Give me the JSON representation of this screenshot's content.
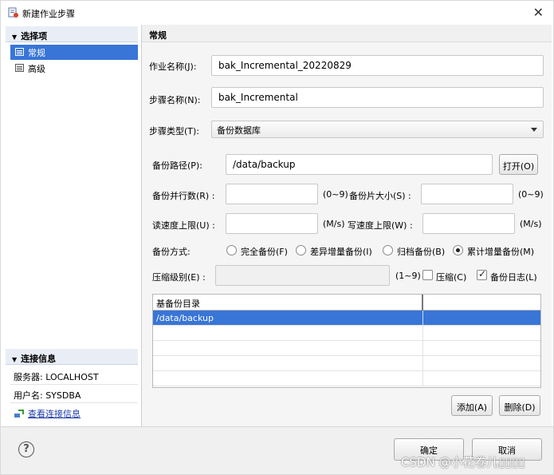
{
  "window": {
    "title": "新建作业步骤",
    "close_glyph": "✕"
  },
  "nav": {
    "header": "选择项",
    "items": [
      {
        "label": "常规",
        "selected": true
      },
      {
        "label": "高级",
        "selected": false
      }
    ]
  },
  "connection": {
    "header": "连接信息",
    "server": "服务器: LOCALHOST",
    "user": "用户名: SYSDBA",
    "view_link": "查看连接信息"
  },
  "page": {
    "title": "常规"
  },
  "form": {
    "job_name_label": "作业名称(J):",
    "job_name_value": "bak_Incremental_20220829",
    "step_name_label": "步骤名称(N):",
    "step_name_value": "bak_Incremental",
    "step_type_label": "步骤类型(T):",
    "step_type_value": "备份数据库",
    "backup_path_label": "备份路径(P):",
    "backup_path_value": "/data/backup",
    "open_button": "打开(O)",
    "parallel_label": "备份并行数(R) :",
    "parallel_value": "",
    "parallel_range": "(0~9)",
    "piece_size_label": "备份片大小(S) :",
    "piece_size_value": "",
    "piece_size_range": "(0~9)",
    "read_limit_label": "读速度上限(U) :",
    "read_limit_value": "",
    "read_unit": "(M/s)",
    "write_limit_label": "写速度上限(W) :",
    "write_limit_value": "",
    "write_unit": "(M/s)",
    "mode_label": "备份方式:",
    "modes": [
      {
        "label": "完全备份(F)",
        "checked": false
      },
      {
        "label": "差异增量备份(I)",
        "checked": false
      },
      {
        "label": "归档备份(B)",
        "checked": false
      },
      {
        "label": "累计增量备份(M)",
        "checked": true
      }
    ],
    "compress_level_label": "压缩级别(E) :",
    "compress_level_value": "",
    "compress_range": "(1~9)",
    "compress_check": {
      "label": "压缩(C)",
      "checked": false
    },
    "log_check": {
      "label": "备份日志(L)",
      "checked": true
    }
  },
  "base_dir_table": {
    "header": "基备份目录",
    "rows": [
      "/data/backup",
      "",
      "",
      "",
      ""
    ]
  },
  "table_buttons": {
    "add": "添加(A)",
    "delete": "删除(D)"
  },
  "footer": {
    "help_glyph": "?",
    "ok": "确定",
    "cancel": "取消"
  },
  "watermark": "CSDN @小花卷儿▯▯▯▯",
  "colors": {
    "selection": "#3875d7",
    "header_bg": "#e9eef6"
  }
}
